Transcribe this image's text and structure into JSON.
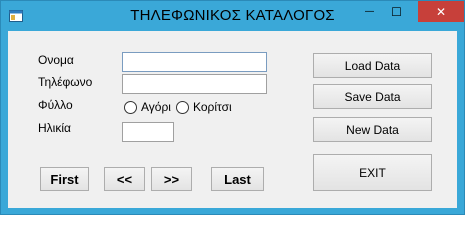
{
  "window": {
    "title": "ΤΗΛΕΦΩΝΙΚΟΣ ΚΑΤΑΛΟΓΟΣ",
    "minimize_glyph": "—",
    "maximize_glyph": "☐",
    "close_glyph": "✕",
    "accent_color": "#3aa8d8",
    "close_color": "#c7403a"
  },
  "form": {
    "name_label": "Ονομα",
    "phone_label": "Τηλέφωνο",
    "gender_label": "Φύλλο",
    "age_label": "Ηλικία",
    "name_value": "",
    "phone_value": "",
    "age_value": "",
    "gender_options": {
      "boy": "Αγόρι",
      "girl": "Κορίτσι"
    }
  },
  "buttons": {
    "load": "Load Data",
    "save": "Save Data",
    "new": "New Data",
    "exit": "EXIT",
    "first": "First",
    "prev": "<<",
    "next": ">>",
    "last": "Last"
  }
}
